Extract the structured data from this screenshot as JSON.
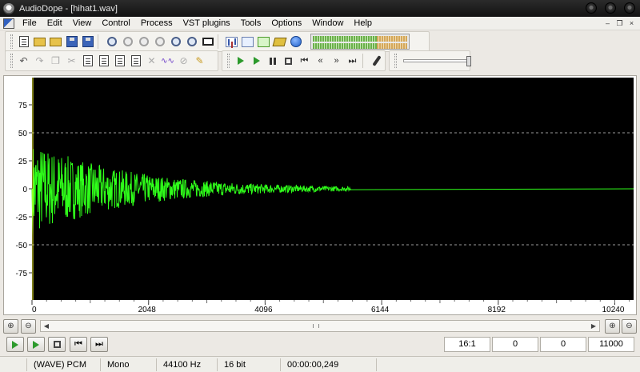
{
  "window": {
    "title": "AudioDope - [hihat1.wav]"
  },
  "menu": [
    "File",
    "Edit",
    "View",
    "Control",
    "Process",
    "VST plugins",
    "Tools",
    "Options",
    "Window",
    "Help"
  ],
  "waveform": {
    "y_ticks": [
      "75",
      "50",
      "25",
      "0",
      "-25",
      "-50",
      "-75"
    ],
    "x_ticks": [
      "0",
      "2048",
      "4096",
      "6144",
      "8192",
      "10240"
    ],
    "colors": {
      "wave": "#2fff1a",
      "background": "#000000",
      "grid": "#9a9a9a",
      "cursor": "#ffff33"
    }
  },
  "transport_fields": {
    "zoom": "16:1",
    "selection_start": "0",
    "selection_end": "0",
    "position": "11000"
  },
  "status": {
    "format": "(WAVE) PCM",
    "channels": "Mono",
    "sample_rate": "44100 Hz",
    "bit_depth": "16 bit",
    "time": "00:00:00,249"
  }
}
